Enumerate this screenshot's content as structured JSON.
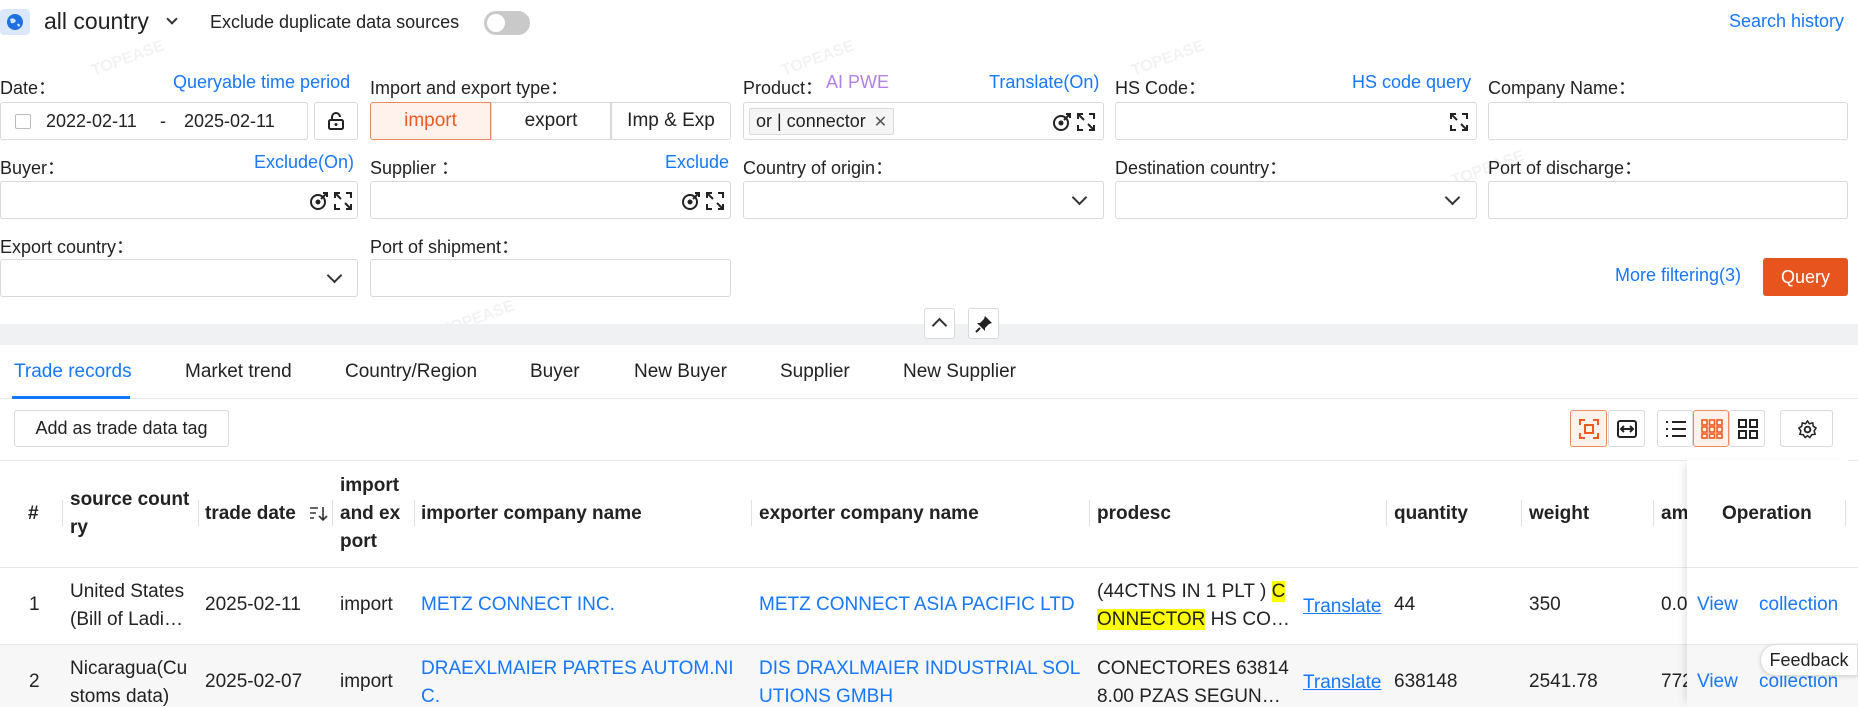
{
  "header": {
    "country_selector": "all country",
    "exclude_duplicates_label": "Exclude duplicate data sources",
    "search_history": "Search history"
  },
  "filters": {
    "date": {
      "label": "Date：",
      "link": "Queryable time period",
      "start": "2022-02-11",
      "separator": "-",
      "end": "2025-02-11"
    },
    "import_export": {
      "label": "Import and export type：",
      "options": [
        "import",
        "export",
        "Imp & Exp"
      ],
      "selected": "import"
    },
    "product": {
      "label": "Product：",
      "ai_link": "AI PWE",
      "translate_link": "Translate(On)",
      "tag": "or | connector"
    },
    "hs_code": {
      "label": "HS Code：",
      "link": "HS code query"
    },
    "company_name": {
      "label": "Company Name："
    },
    "buyer": {
      "label": "Buyer：",
      "link": "Exclude(On)"
    },
    "supplier": {
      "label": "Supplier ：",
      "link": "Exclude"
    },
    "country_of_origin": {
      "label": "Country of origin："
    },
    "destination_country": {
      "label": "Destination country："
    },
    "port_of_discharge": {
      "label": "Port of discharge："
    },
    "export_country": {
      "label": "Export country："
    },
    "port_of_shipment": {
      "label": "Port of shipment："
    },
    "more_filtering": "More filtering(3)",
    "query_button": "Query"
  },
  "tabs": [
    "Trade records",
    "Market trend",
    "Country/Region",
    "Buyer",
    "New Buyer",
    "Supplier",
    "New Supplier"
  ],
  "toolbar": {
    "add_tag": "Add as trade data tag"
  },
  "table": {
    "headers": {
      "index": "#",
      "source_country": "source country",
      "trade_date": "trade date",
      "import_export": "import and export",
      "importer": "importer company name",
      "exporter": "exporter company name",
      "prodesc": "prodesc",
      "quantity": "quantity",
      "weight": "weight",
      "amount": "am",
      "operation": "Operation"
    },
    "rows": [
      {
        "index": "1",
        "source_country": "United States (Bill of Ladi…",
        "trade_date": "2025-02-11",
        "type": "import",
        "importer": "METZ CONNECT INC.",
        "exporter": "METZ CONNECT ASIA PACIFIC LTD",
        "prodesc_pre": "(44CTNS IN 1 PLT ) ",
        "prodesc_hl1": "C",
        "prodesc_hl2": "ONNECTOR",
        "prodesc_post": " HS CO…",
        "translate": "Translate",
        "quantity": "44",
        "weight": "350",
        "amount": "0.0",
        "view": "View",
        "collection": "collection"
      },
      {
        "index": "2",
        "source_country": "Nicaragua(Customs data)",
        "trade_date": "2025-02-07",
        "type": "import",
        "importer": "DRAEXLMAIER PARTES AUTOM.NIC.",
        "exporter": "DIS DRAXLMAIER INDUSTRIAL SOLUTIONS GMBH",
        "prodesc": "CONECTORES 638148.00 PZAS SEGUN…",
        "translate": "Translate",
        "quantity": "638148",
        "weight": "2541.78",
        "amount": "772",
        "view": "View",
        "collection": "collection"
      }
    ]
  },
  "feedback": "Feedback"
}
